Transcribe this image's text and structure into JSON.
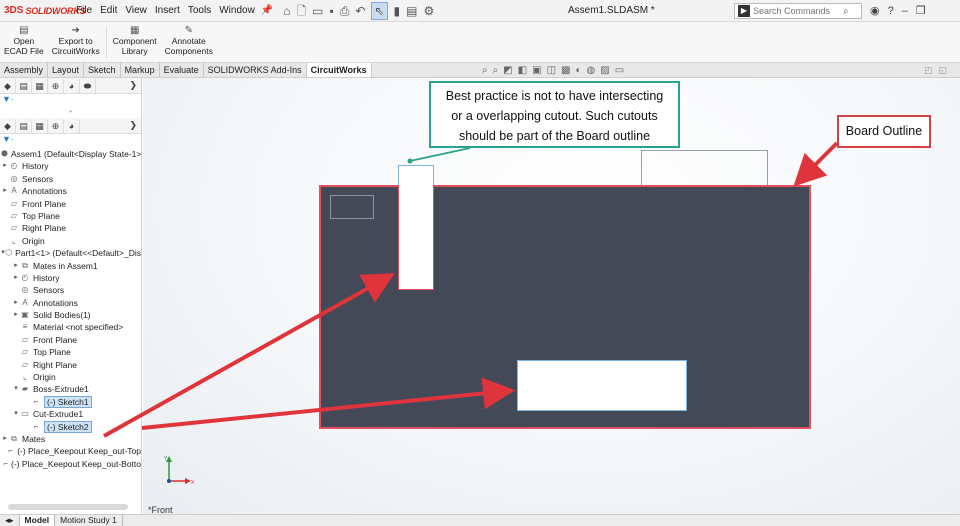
{
  "app": {
    "logo_mark": "3DS",
    "logo_text": "SOLIDWORKS",
    "document_title": "Assem1.SLDASM *"
  },
  "menu": [
    "File",
    "Edit",
    "View",
    "Insert",
    "Tools",
    "Window"
  ],
  "search": {
    "placeholder": "Search Commands"
  },
  "commands": [
    {
      "line1": "Open",
      "line2": "ECAD File"
    },
    {
      "line1": "Export to",
      "line2": "CircuitWorks"
    },
    {
      "line1": "Component",
      "line2": "Library"
    },
    {
      "line1": "Annotate",
      "line2": "Components"
    }
  ],
  "tabs": [
    {
      "label": "Assembly",
      "active": false
    },
    {
      "label": "Layout",
      "active": false
    },
    {
      "label": "Sketch",
      "active": false
    },
    {
      "label": "Markup",
      "active": false
    },
    {
      "label": "Evaluate",
      "active": false
    },
    {
      "label": "SOLIDWORKS Add-Ins",
      "active": false
    },
    {
      "label": "CircuitWorks",
      "active": true
    }
  ],
  "tree": [
    {
      "label": "Assem1  (Default<Display State-1>)",
      "icon": "assembly-icon",
      "level": 0,
      "toggle": ""
    },
    {
      "label": "History",
      "icon": "history-icon",
      "level": 0,
      "toggle": "▸"
    },
    {
      "label": "Sensors",
      "icon": "sensors-icon",
      "level": 0,
      "toggle": ""
    },
    {
      "label": "Annotations",
      "icon": "annotations-icon",
      "level": 0,
      "toggle": "▸"
    },
    {
      "label": "Front Plane",
      "icon": "plane-icon",
      "level": 0,
      "toggle": ""
    },
    {
      "label": "Top Plane",
      "icon": "plane-icon",
      "level": 0,
      "toggle": ""
    },
    {
      "label": "Right Plane",
      "icon": "plane-icon",
      "level": 0,
      "toggle": ""
    },
    {
      "label": "Origin",
      "icon": "origin-icon",
      "level": 0,
      "toggle": ""
    },
    {
      "label": "Part1<1> (Default<<Default>_Dis",
      "icon": "part-icon",
      "level": 0,
      "toggle": "▾"
    },
    {
      "label": "Mates in Assem1",
      "icon": "mates-icon",
      "level": 1,
      "toggle": "▸"
    },
    {
      "label": "History",
      "icon": "history-icon",
      "level": 1,
      "toggle": "▸"
    },
    {
      "label": "Sensors",
      "icon": "sensors-icon",
      "level": 1,
      "toggle": ""
    },
    {
      "label": "Annotations",
      "icon": "annotations-icon",
      "level": 1,
      "toggle": "▸"
    },
    {
      "label": "Solid Bodies(1)",
      "icon": "solid-bodies-icon",
      "level": 1,
      "toggle": "▸"
    },
    {
      "label": "Material <not specified>",
      "icon": "material-icon",
      "level": 1,
      "toggle": ""
    },
    {
      "label": "Front Plane",
      "icon": "plane-icon",
      "level": 1,
      "toggle": ""
    },
    {
      "label": "Top Plane",
      "icon": "plane-icon",
      "level": 1,
      "toggle": ""
    },
    {
      "label": "Right Plane",
      "icon": "plane-icon",
      "level": 1,
      "toggle": ""
    },
    {
      "label": "Origin",
      "icon": "origin-icon",
      "level": 1,
      "toggle": ""
    },
    {
      "label": "Boss-Extrude1",
      "icon": "extrude-icon",
      "level": 1,
      "toggle": "▾"
    },
    {
      "label": "(-) Sketch1",
      "icon": "sketch-icon",
      "level": 2,
      "toggle": "",
      "highlight": true
    },
    {
      "label": "Cut-Extrude1",
      "icon": "cut-icon",
      "level": 1,
      "toggle": "▾"
    },
    {
      "label": "(-) Sketch2",
      "icon": "sketch-icon",
      "level": 2,
      "toggle": "",
      "highlight": true
    },
    {
      "label": "Mates",
      "icon": "mates-icon",
      "level": 0,
      "toggle": "▸"
    },
    {
      "label": "(-) Place_Keepout Keep_out-Top",
      "icon": "sketch-icon",
      "level": 0,
      "toggle": ""
    },
    {
      "label": "(-) Place_Keepout Keep_out-Botto",
      "icon": "sketch-icon",
      "level": 0,
      "toggle": ""
    }
  ],
  "bottom_tabs": [
    {
      "label": "Model",
      "active": true
    },
    {
      "label": "Motion Study 1",
      "active": false
    }
  ],
  "viewport": {
    "view_label": "*Front",
    "triad": {
      "y": "Y",
      "x": "X"
    }
  },
  "callouts": {
    "best_practice": {
      "line1": "Best practice is not to have intersecting",
      "line2": "or a overlapping cutout. Such cutouts",
      "line3": "should be part of the Board outline"
    },
    "board_outline": "Board Outline"
  },
  "colors": {
    "board_fill": "#434956",
    "board_edge": "#e0505f",
    "cutout_edge": "#7db4e0",
    "arrow_red": "#e0343c",
    "callout_teal": "#2aa28f"
  }
}
